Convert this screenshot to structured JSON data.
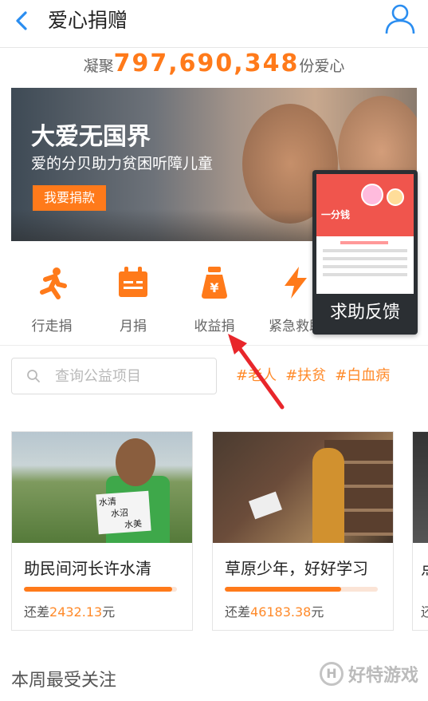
{
  "header": {
    "title": "爱心捐赠",
    "back_icon": "back-chevron-icon",
    "user_icon": "user-icon",
    "accent_color": "#2a8df0"
  },
  "summary": {
    "prefix": "凝聚",
    "count": "797,690,348",
    "suffix": "份爱心"
  },
  "banner": {
    "headline": "大爱无国界",
    "subline": "爱的分贝助力贫困听障儿童",
    "cta_label": "我要捐款"
  },
  "floating_feedback": {
    "label": "求助反馈"
  },
  "categories": [
    {
      "label": "行走捐",
      "icon": "running-icon"
    },
    {
      "label": "月捐",
      "icon": "calendar-icon"
    },
    {
      "label": "收益捐",
      "icon": "money-bag-icon"
    },
    {
      "label": "紧急救助",
      "icon": "lightning-icon"
    }
  ],
  "search": {
    "placeholder": "查询公益项目",
    "value": ""
  },
  "tags": [
    "#老人",
    "#扶贫",
    "#白血病"
  ],
  "projects": [
    {
      "title": "助民间河长许水清",
      "need_prefix": "还差",
      "amount": "2432.13",
      "need_suffix": "元",
      "progress": 0.97,
      "photo_text": [
        "水清",
        "水沼",
        "水美"
      ]
    },
    {
      "title": "草原少年，好好学习",
      "need_prefix": "还差",
      "amount": "46183.38",
      "need_suffix": "元",
      "progress": 0.76
    },
    {
      "title": "点",
      "need_prefix": "还",
      "amount": "",
      "need_suffix": "",
      "progress": 0.5
    }
  ],
  "section": {
    "title": "本周最受关注"
  },
  "watermark": {
    "text": "好特游戏",
    "logo_letter": "H"
  },
  "colors": {
    "accent_orange": "#ff7a1a",
    "annotation_red": "#e8262b"
  }
}
